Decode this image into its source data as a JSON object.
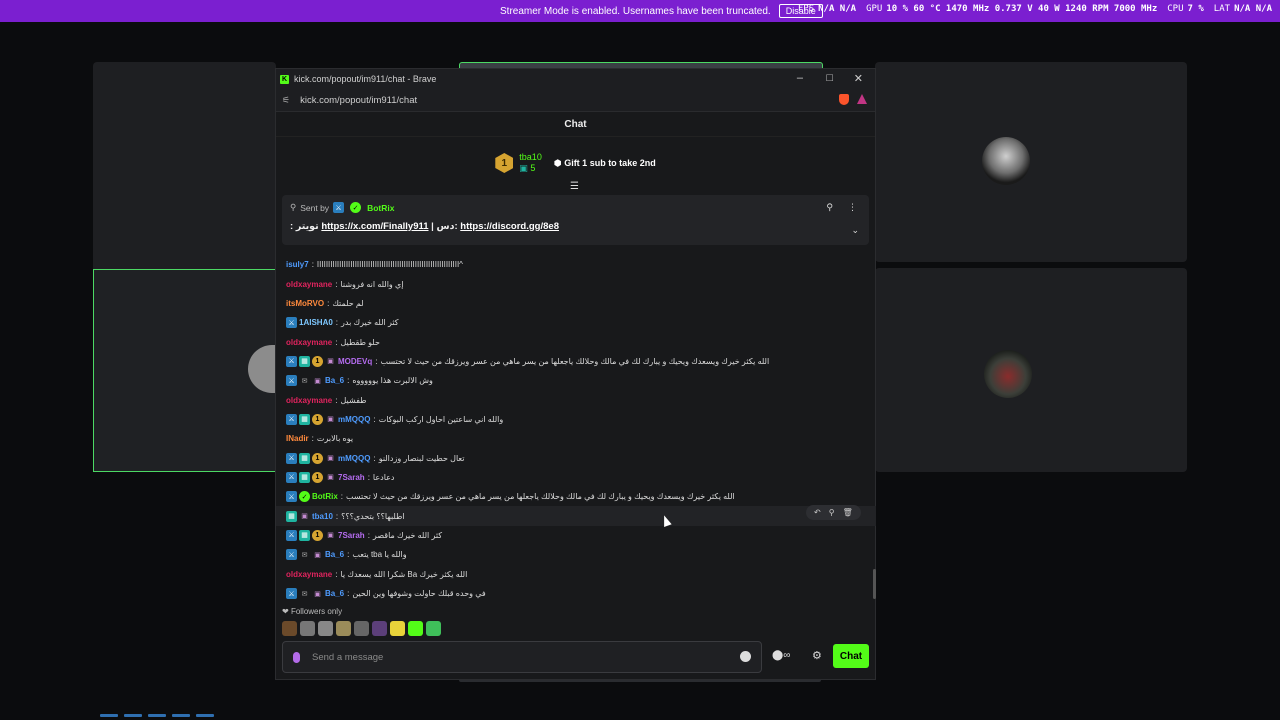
{
  "overlay": {
    "streamer_mode_text": "Streamer Mode is enabled. Usernames have been truncated.",
    "disable_label": "Disable",
    "stats": [
      {
        "label": "FPS",
        "value": "N/A  N/A"
      },
      {
        "label": "GPU",
        "value": "10 %  60 °C  1470 MHz  0.737 V  40 W  1240 RPM  7000 MHz"
      },
      {
        "label": "CPU",
        "value": "7 %"
      },
      {
        "label": "LAT",
        "value": "N/A  N/A"
      }
    ]
  },
  "window": {
    "title": "kick.com/popout/im911/chat - Brave",
    "url": "kick.com/popout/im911/chat",
    "controls": {
      "minimize": "–",
      "maximize": "□",
      "close": "✕"
    },
    "brave_badge": "1"
  },
  "chat": {
    "header": "Chat",
    "leaderboard": {
      "rank": "1",
      "user": "tba10",
      "count": "5",
      "gift_text": "Gift 1 sub to take 2nd"
    },
    "pinned": {
      "sent_by_label": "Sent by",
      "user": "BotRix",
      "body_prefix": ": تويتر",
      "link1": "https://x.com/Finally911",
      "separator": "| دس:",
      "link2": "https://discord.gg/8e8"
    },
    "messages": [
      {
        "user": "isuly7",
        "color": "#4f9cff",
        "badges": [],
        "text": "^اااااااااااااااااااااااااااااااااااااااااااااااااااااااااااااااا"
      },
      {
        "user": "oldxaymane",
        "color": "#e0245e",
        "badges": [],
        "text": "إي والله انه فروشنا"
      },
      {
        "user": "itsMoRVO",
        "color": "#ff8a3d",
        "badges": [],
        "text": "لم حلمتك"
      },
      {
        "user": "1AISHA0",
        "color": "#7ec8ff",
        "badges": [
          "mod"
        ],
        "text": "كثر الله خيرك بدر"
      },
      {
        "user": "oldxaymane",
        "color": "#e0245e",
        "badges": [],
        "text": "حلو طقطيل"
      },
      {
        "user": "MODEVq",
        "color": "#b56cf0",
        "badges": [
          "mod",
          "vip",
          "og",
          "sub"
        ],
        "text": "الله يكثر خيرك ويسعدك ويحيك و يبارك لك في مالك وحلالك ياجعلها من يسر ماهي من عسر ويرزقك من حيث لا تحتسب"
      },
      {
        "user": "Ba_6",
        "color": "#4f9cff",
        "badges": [
          "mod",
          "gift",
          "sub"
        ],
        "text": "وش الالبرت هذا يوووووه"
      },
      {
        "user": "oldxaymane",
        "color": "#e0245e",
        "badges": [],
        "text": "طفشيل"
      },
      {
        "user": "mMQQQ",
        "color": "#4f9cff",
        "badges": [
          "mod",
          "vip",
          "og",
          "sub"
        ],
        "text": "والله اني ساعتين احاول اركب البوكات"
      },
      {
        "user": "INadir",
        "color": "#ff8a3d",
        "badges": [],
        "text": "يوه بالابرت"
      },
      {
        "user": "mMQQQ",
        "color": "#4f9cff",
        "badges": [
          "mod",
          "vip",
          "og",
          "sub"
        ],
        "text": "تعال حطيت لبنصار وزدالنو"
      },
      {
        "user": "7Sarah",
        "color": "#b56cf0",
        "badges": [
          "mod",
          "vip",
          "og",
          "sub"
        ],
        "text": "دعادعا"
      },
      {
        "user": "BotRix",
        "color": "#53fc18",
        "badges": [
          "mod",
          "verified"
        ],
        "text": "الله يكثر خيرك ويسعدك ويحيك و يبارك لك في مالك وحلالك ياجعلها من يسر ماهي من عسر ويرزقك من حيث لا تحتسب"
      },
      {
        "user": "tba10",
        "color": "#4f9cff",
        "badges": [
          "vip",
          "sub"
        ],
        "text": "اطلبها؟؟ بتحدي؟؟؟",
        "highlight": true
      },
      {
        "user": "7Sarah",
        "color": "#b56cf0",
        "badges": [
          "mod",
          "vip",
          "og",
          "sub"
        ],
        "text": "كثر الله خيرك ماقصر"
      },
      {
        "user": "Ba_6",
        "color": "#4f9cff",
        "badges": [
          "mod",
          "gift",
          "sub"
        ],
        "text": "والله يا tba يتعب"
      },
      {
        "user": "oldxaymane",
        "color": "#e0245e",
        "badges": [],
        "text": "الله يكثر خيرك Ba شكرا الله يسعدك يا"
      },
      {
        "user": "Ba_6",
        "color": "#4f9cff",
        "badges": [
          "mod",
          "gift",
          "sub"
        ],
        "text": "في وحده قبلك حاولت وشوفها وين الحين"
      }
    ],
    "followers_only": "Followers only",
    "input_placeholder": "Send a message",
    "send_label": "Chat",
    "emote_colors": [
      "#6b4a2a",
      "#777",
      "#888",
      "#9b8c5a",
      "#666",
      "#5c3f7a",
      "#e8d23a",
      "#53fc18",
      "#3fbf5a"
    ]
  }
}
